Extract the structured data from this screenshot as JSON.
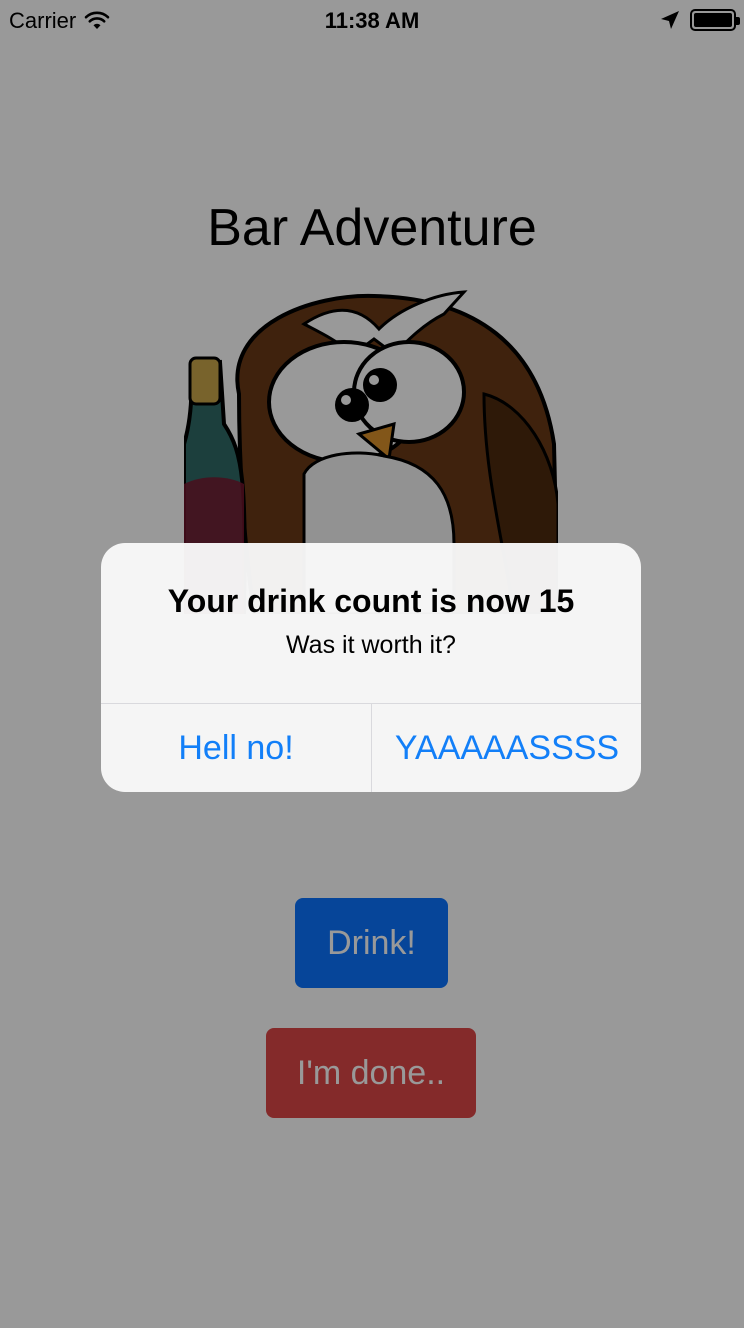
{
  "status_bar": {
    "carrier": "Carrier",
    "time": "11:38 AM"
  },
  "app": {
    "title": "Bar Adventure",
    "drink_button": "Drink!",
    "done_button": "I'm done.."
  },
  "alert": {
    "title": "Your drink count is now 15",
    "message": "Was it worth it?",
    "actions": [
      "Hell no!",
      "YAAAAASSSS"
    ]
  },
  "colors": {
    "drink_button": "#0a74ff",
    "done_button": "#dd4747",
    "alert_action": "#127ff8"
  }
}
